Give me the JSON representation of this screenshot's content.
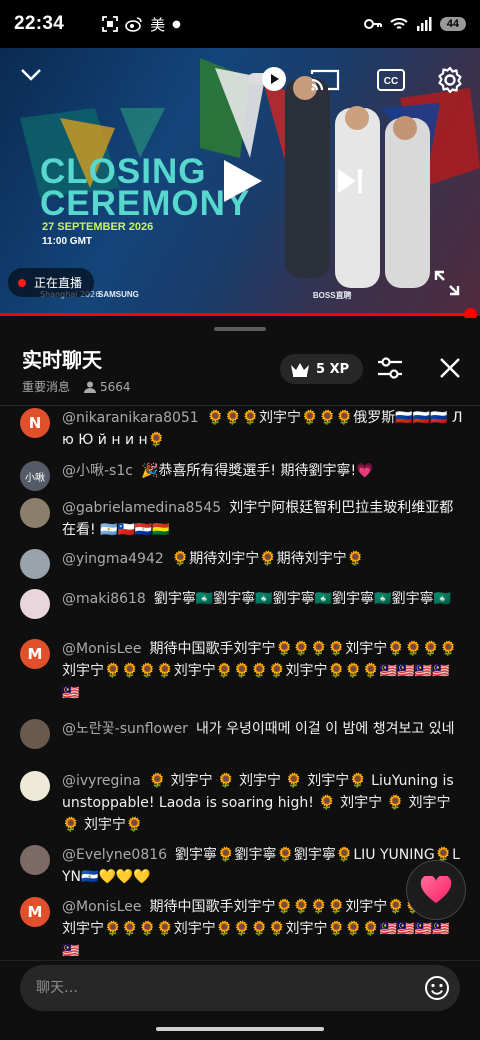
{
  "status_bar": {
    "time": "22:34",
    "carrier_label": "美",
    "battery": "44"
  },
  "video": {
    "event_title": "CLOSING\nCEREMONY",
    "event_date": "27 SEPTEMBER 2026",
    "event_time": "11:00 GMT",
    "host_city": "Shanghai 2026",
    "sponsors": [
      "SAMSUNG",
      "BOSS直聘"
    ],
    "live_label": "正在直播",
    "progress_percent": 98
  },
  "chat": {
    "title": "实时聊天",
    "filter_label": "重要消息",
    "viewer_count": "5664",
    "xp_label": "5 XP",
    "messages": [
      {
        "author": "@nikaranikara8051",
        "avatar_letter": "N",
        "avatar_color": "#e0512b",
        "text": "🌻🌻🌻刘宇宁🌻🌻🌻俄罗斯🇷🇺🇷🇺🇷🇺 Л ю Ю й н и н🌻"
      },
      {
        "author": "@小啾-s1c",
        "avatar_letter": "小啾",
        "avatar_color": "#555b66",
        "text": "🎉恭喜所有得獎選手! 期待劉宇寧!💗"
      },
      {
        "author": "@gabrielamedina8545",
        "avatar_letter": "",
        "avatar_color": "#8a7f6a",
        "text": "刘宇宁阿根廷智利巴拉圭玻利维亚都在看! 🇦🇷🇨🇱🇵🇾🇧🇴"
      },
      {
        "author": "@yingma4942",
        "avatar_letter": "",
        "avatar_color": "#9aa3ab",
        "text": "🌻期待刘宇宁🌻期待刘宇宁🌻"
      },
      {
        "author": "@maki8618",
        "avatar_letter": "",
        "avatar_color": "#e8d6dc",
        "text": "劉宇寧🇲🇴劉宇寧🇲🇴劉宇寧🇲🇴劉宇寧🇲🇴劉宇寧🇲🇴"
      },
      {
        "author": "@MonisLee",
        "avatar_letter": "M",
        "avatar_color": "#e0512b",
        "text": "期待中国歌手刘宇宁🌻🌻🌻🌻刘宇宁🌻🌻🌻🌻刘宇宁🌻🌻🌻🌻刘宇宁🌻🌻🌻🌻刘宇宁🌻🌻🌻🇲🇾🇲🇾🇲🇾🇲🇾🇲🇾"
      },
      {
        "author": "@노란꽃-sunflower",
        "avatar_letter": "",
        "avatar_color": "#6a5a4e",
        "text": "내가 우녕이때메 이걸 이 밤에 챙겨보고 있네"
      },
      {
        "author": "@ivyregina",
        "avatar_letter": "",
        "avatar_color": "#efe9d8",
        "text": "🌻 刘宇宁 🌻 刘宇宁 🌻 刘宇宁🌻 LiuYuning is unstoppable! Laoda is soaring high! 🌻 刘宇宁 🌻 刘宇宁 🌻 刘宇宁🌻"
      },
      {
        "author": "@Evelyne0816",
        "avatar_letter": "",
        "avatar_color": "#7d6a66",
        "text": "劉宇寧🌻劉宇寧🌻劉宇寧🌻LIU YUNING🌻LYN🇸🇻💛💛💛"
      },
      {
        "author": "@MonisLee",
        "avatar_letter": "M",
        "avatar_color": "#e0512b",
        "text": "期待中国歌手刘宇宁🌻🌻🌻🌻刘宇宁🌻🌻🌻🌻刘宇宁🌻🌻🌻🌻刘宇宁🌻🌻🌻🌻刘宇宁🌻🌻🌻🇲🇾🇲🇾🇲🇾🇲🇾🇲🇾"
      }
    ],
    "input_placeholder": "聊天…"
  }
}
